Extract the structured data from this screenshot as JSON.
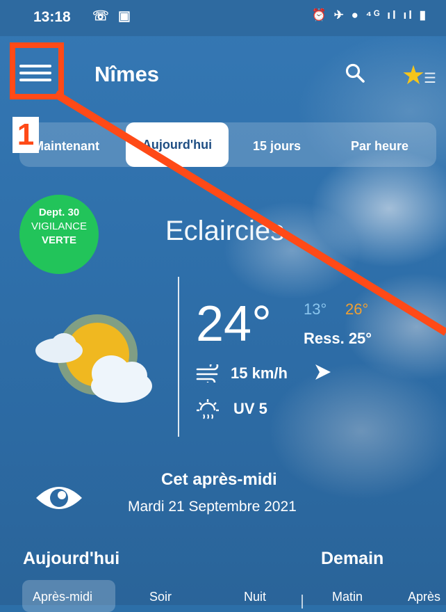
{
  "status": {
    "time": "13:18",
    "left_icons": "☏ ▣",
    "right_icons": "⏰ ✈ ● ⁴ᴳ ıl ıl ▮"
  },
  "header": {
    "city": "Nîmes"
  },
  "tabs": {
    "items": [
      "Maintenant",
      "Aujourd'hui",
      "15 jours",
      "Par heure"
    ],
    "active": "Aujourd'hui"
  },
  "annotation": {
    "label": "1",
    "color": "#ff4a17"
  },
  "vigilance": {
    "line1": "Dept. 30",
    "line2": "VIGILANCE",
    "line3": "VERTE",
    "color": "#22c45a"
  },
  "weather": {
    "condition": "Eclaircies",
    "temperature": "24°",
    "min": "13°",
    "max": "26°",
    "feels_like": "Ress. 25°",
    "wind": "15 km/h",
    "uv": "UV 5"
  },
  "period": {
    "title": "Cet après-midi",
    "date": "Mardi 21 Septembre 2021"
  },
  "forecast": {
    "today_label": "Aujourd'hui",
    "tomorrow_label": "Demain",
    "slots": [
      "Après-midi",
      "Soir",
      "Nuit",
      "Matin",
      "Après"
    ]
  }
}
